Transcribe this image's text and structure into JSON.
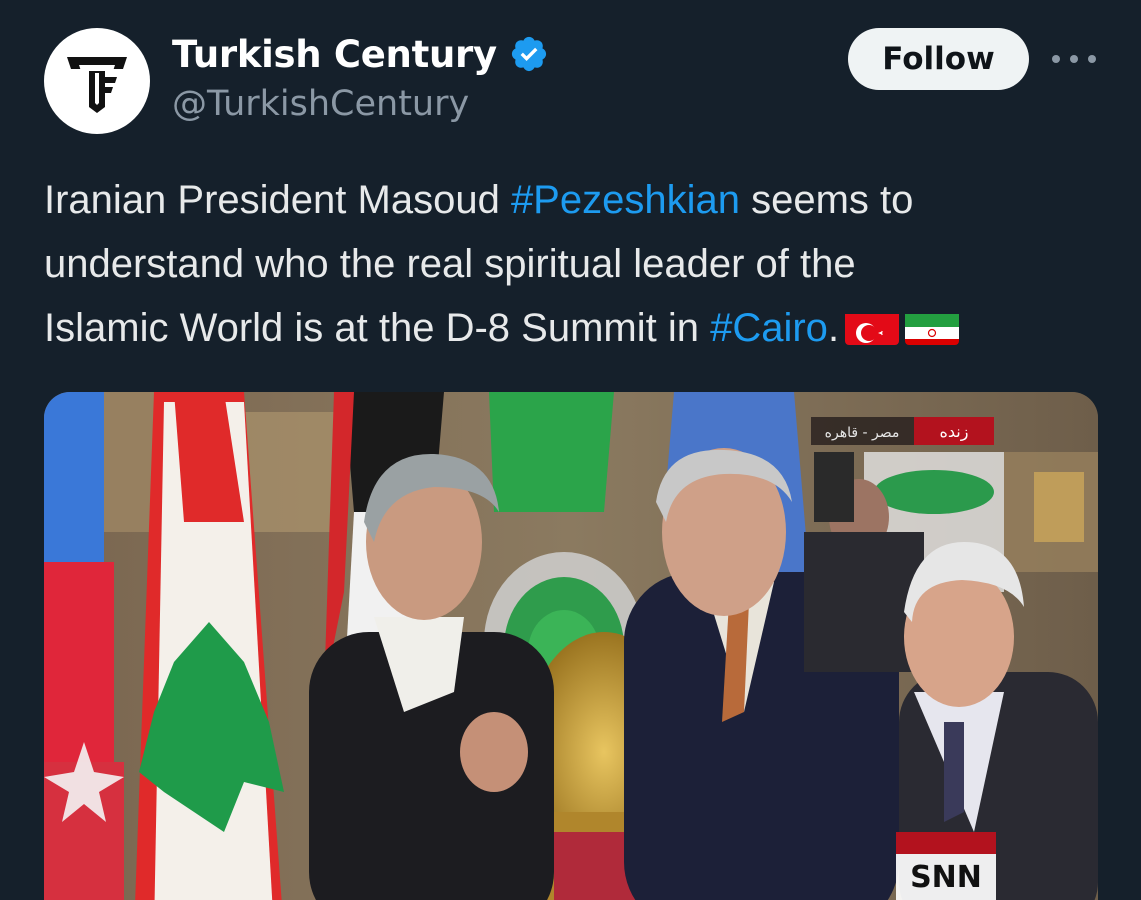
{
  "author": {
    "display_name": "Turkish Century",
    "handle": "@TurkishCentury",
    "verified": true,
    "avatar_icon": "tc-monogram-logo"
  },
  "actions": {
    "follow_label": "Follow",
    "more_icon": "more-horizontal-icon"
  },
  "tweet": {
    "line1_pre": "Iranian President Masoud ",
    "line1_tag": "#Pezeshkian",
    "line1_post": " seems to",
    "line2": "understand who the real spiritual leader of the",
    "line3_pre": "Islamic World is at the D-8 Summit in ",
    "line3_tag": "#Cairo",
    "line3_post": ".",
    "flags": [
      "turkey-flag",
      "iran-flag"
    ]
  },
  "media": {
    "live_badge": "زنده",
    "location_text": "مصر - قاهره",
    "channel_logo": "SNN"
  },
  "colors": {
    "background": "#15202b",
    "link": "#1d9bf0",
    "verified": "#1d9bf0",
    "secondary_text": "#8b98a5"
  }
}
